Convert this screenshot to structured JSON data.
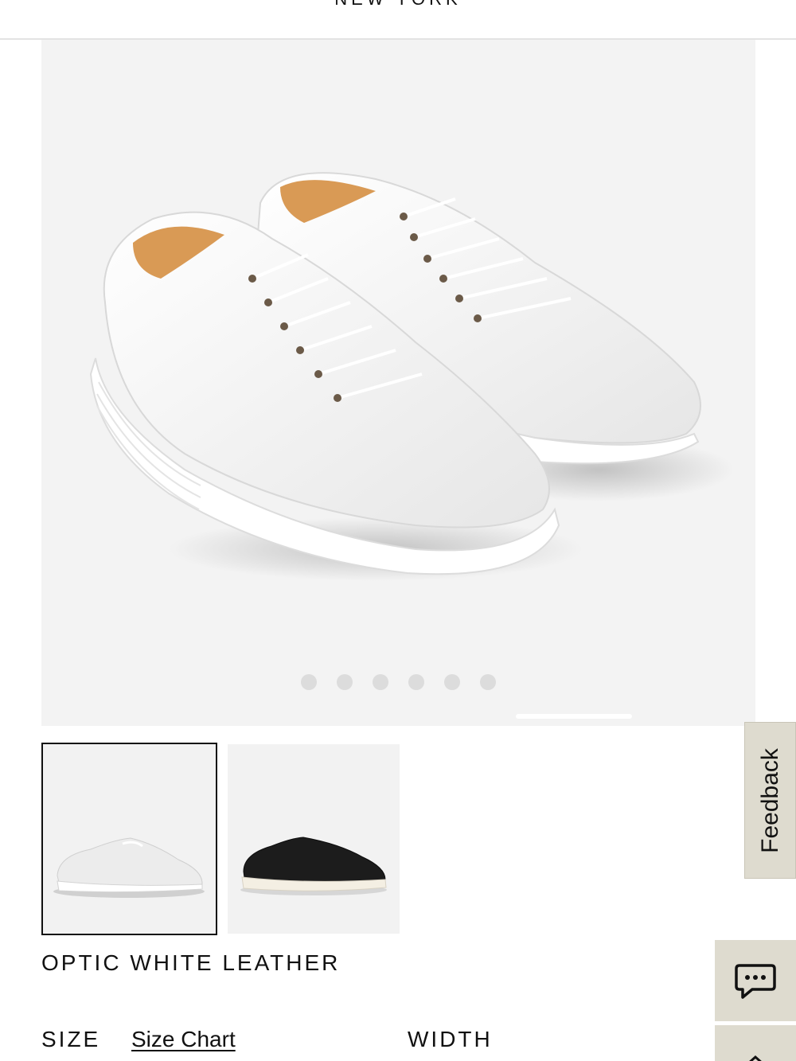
{
  "header": {
    "brand_sub": "NEW YORK"
  },
  "gallery": {
    "dot_count": 6,
    "image_alt": "white leather sneakers"
  },
  "swatches": [
    {
      "name": "optic-white-leather",
      "selected": true
    },
    {
      "name": "black-leather",
      "selected": false
    }
  ],
  "product": {
    "color_name": "OPTIC WHITE LEATHER",
    "size_label": "SIZE",
    "size_chart_label": "Size Chart",
    "width_label": "WIDTH"
  },
  "feedback": {
    "label": "Feedback"
  },
  "chat": {
    "icon": "chat-bubble-icon"
  },
  "colors": {
    "tab_bg": "#dedbcf",
    "hero_bg": "#f3f3f3"
  }
}
